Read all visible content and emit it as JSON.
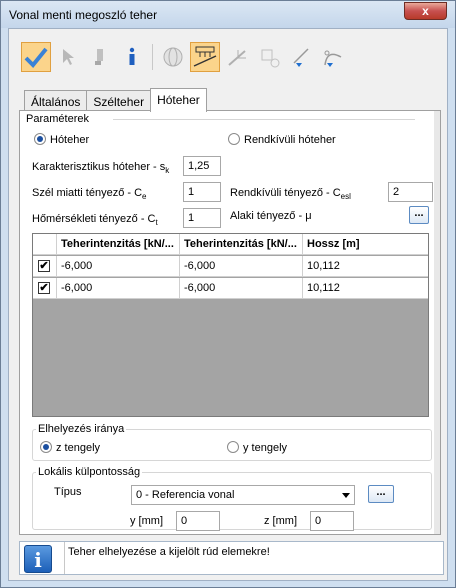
{
  "window": {
    "title": "Vonal menti megoszló teher",
    "close_label": "x"
  },
  "toolbar": {
    "icons": [
      "check-icon",
      "pointer-icon",
      "cursor-tool-icon",
      "info-icon",
      "sphere-icon",
      "snow-load-icon",
      "line-tool-icon",
      "node-grid-icon",
      "line-arrow-icon",
      "curve-arrow-icon"
    ]
  },
  "tabs": [
    "Általános",
    "Szélteher",
    "Hóteher"
  ],
  "params": {
    "legend": "Paraméterek",
    "radio_normal": "Hóteher",
    "radio_exceptional": "Rendkívüli hóteher",
    "sk_label": "Karakterisztikus hóteher - s",
    "sk_sub": "k",
    "sk_value": "1,25",
    "ce_label": "Szél miatti tényező - C",
    "ce_sub": "e",
    "ce_value": "1",
    "cesl_label": "Rendkívüli tényező - C",
    "cesl_sub": "esl",
    "cesl_value": "2",
    "ct_label": "Hőmérsékleti tényező - C",
    "ct_sub": "t",
    "ct_value": "1",
    "mu_label": "Alaki tényező - μ",
    "mu_button": "..."
  },
  "table": {
    "headers": [
      "Teherintenzitás [kN/...",
      "Teherintenzitás [kN/...",
      "Hossz [m]"
    ],
    "rows": [
      {
        "checked": "✔",
        "c1": "-6,000",
        "c2": "-6,000",
        "c3": "10,112"
      },
      {
        "checked": "✔",
        "c1": "-6,000",
        "c2": "-6,000",
        "c3": "10,112"
      }
    ]
  },
  "placement": {
    "legend": "Elhelyezés iránya",
    "z_label": "z tengely",
    "y_label": "y tengely"
  },
  "eccentricity": {
    "legend": "Lokális külpontosság",
    "type_label": "Típus",
    "type_value": "0 - Referencia vonal",
    "button": "...",
    "y_label": "y [mm]",
    "y_value": "0",
    "z_label": "z [mm]",
    "z_value": "0"
  },
  "status": {
    "message": "Teher elhelyezése a kijelölt rúd elemekre!"
  },
  "colors": {
    "accent": "#1b4fa0",
    "active_tool": "#fbd48b"
  }
}
